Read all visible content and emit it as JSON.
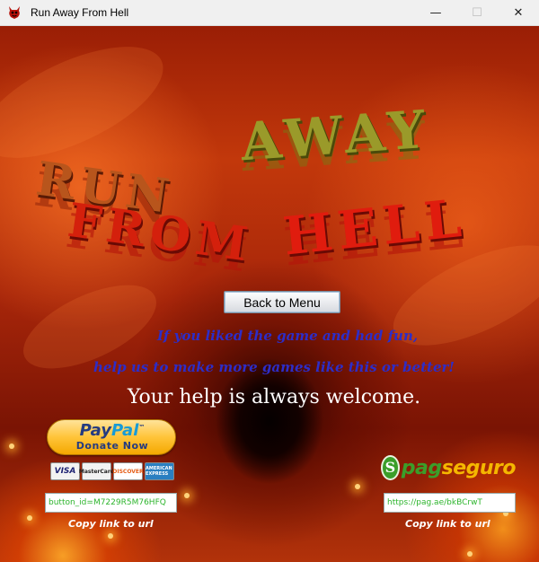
{
  "window": {
    "title": "Run Away From Hell",
    "icon": "devil-icon",
    "controls": {
      "minimize": "—",
      "maximize": "☐",
      "close": "✕"
    }
  },
  "logo": {
    "line1a": "RUN",
    "line1b": "AWAY",
    "line2a": "FROM",
    "line2b": "HELL"
  },
  "menu": {
    "back_label": "Back to Menu"
  },
  "donation": {
    "message_line1": "If you liked the game and had fun,",
    "message_line2": "help us to make more games like this or better!",
    "welcome": "Your help is always welcome.",
    "paypal": {
      "brand_pay": "Pay",
      "brand_pal": "Pal",
      "tm": "™",
      "button_label": "Donate Now",
      "cards": [
        "VISA",
        "MasterCard",
        "DISCOVER",
        "AMERICAN EXPRESS"
      ],
      "link_value": "button_id=M7229R5M76HFQ",
      "copy_label": "Copy link to url"
    },
    "pagseguro": {
      "logo_symbol": "S",
      "logo_pag": "pag",
      "logo_seguro": "seguro",
      "link_value": "https://pag.ae/bkBCrwT",
      "copy_label": "Copy link to url"
    }
  },
  "colors": {
    "message_blue": "#2d2dc8",
    "link_green": "#2db52d",
    "paypal_navy": "#253b80",
    "paypal_light_blue": "#179bd7",
    "pagseguro_green": "#3b9e2a",
    "pagseguro_yellow": "#f5b700"
  }
}
